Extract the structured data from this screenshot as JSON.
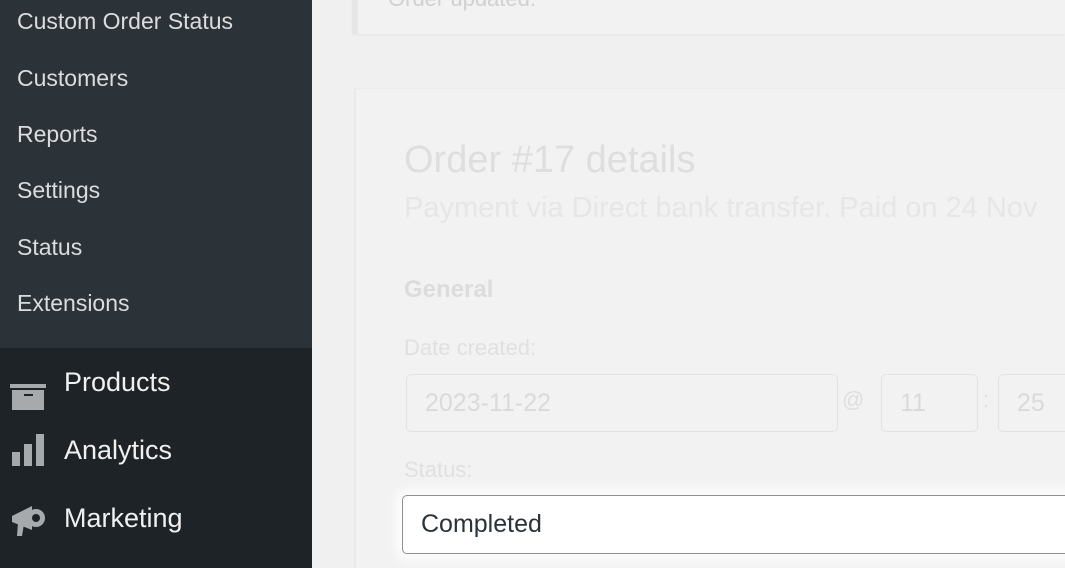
{
  "sidebar": {
    "submenu": [
      "Custom Order Status",
      "Customers",
      "Reports",
      "Settings",
      "Status",
      "Extensions"
    ],
    "menu": [
      {
        "label": "Products",
        "icon": "archive-box-icon"
      },
      {
        "label": "Analytics",
        "icon": "bar-chart-icon"
      },
      {
        "label": "Marketing",
        "icon": "megaphone-icon"
      }
    ]
  },
  "notice": {
    "text": "Order updated."
  },
  "order": {
    "title": "Order #17 details",
    "subtitle": "Payment via Direct bank transfer. Paid on 24 Nov",
    "section": "General",
    "date_label": "Date created:",
    "date": "2023-11-22",
    "at": "@",
    "hour": "11",
    "colon": ":",
    "minute": "25",
    "status_label": "Status:",
    "status": "Completed"
  }
}
